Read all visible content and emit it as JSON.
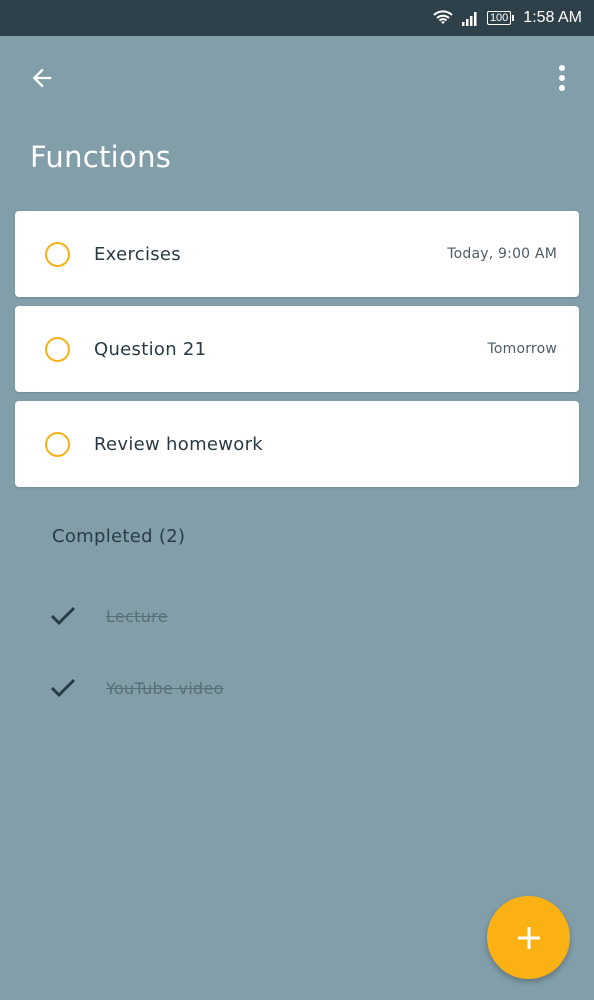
{
  "status_bar": {
    "time": "1:58 AM",
    "battery": "100",
    "icons": [
      "wifi-icon",
      "signal-icon",
      "battery-icon"
    ]
  },
  "toolbar": {
    "back_icon": "arrow-left-icon",
    "menu_icon": "more-vertical-icon"
  },
  "page": {
    "title": "Functions"
  },
  "tasks": [
    {
      "title": "Exercises",
      "due": "Today, 9:00 AM"
    },
    {
      "title": "Question 21",
      "due": "Tomorrow"
    },
    {
      "title": "Review homework",
      "due": ""
    }
  ],
  "completed": {
    "header": "Completed (2)",
    "items": [
      {
        "title": "Lecture"
      },
      {
        "title": "YouTube video"
      }
    ]
  },
  "fab": {
    "icon": "plus-icon"
  },
  "colors": {
    "background": "#819ea9",
    "status_bar": "#2e404a",
    "accent": "#fbb014",
    "card": "#ffffff"
  }
}
